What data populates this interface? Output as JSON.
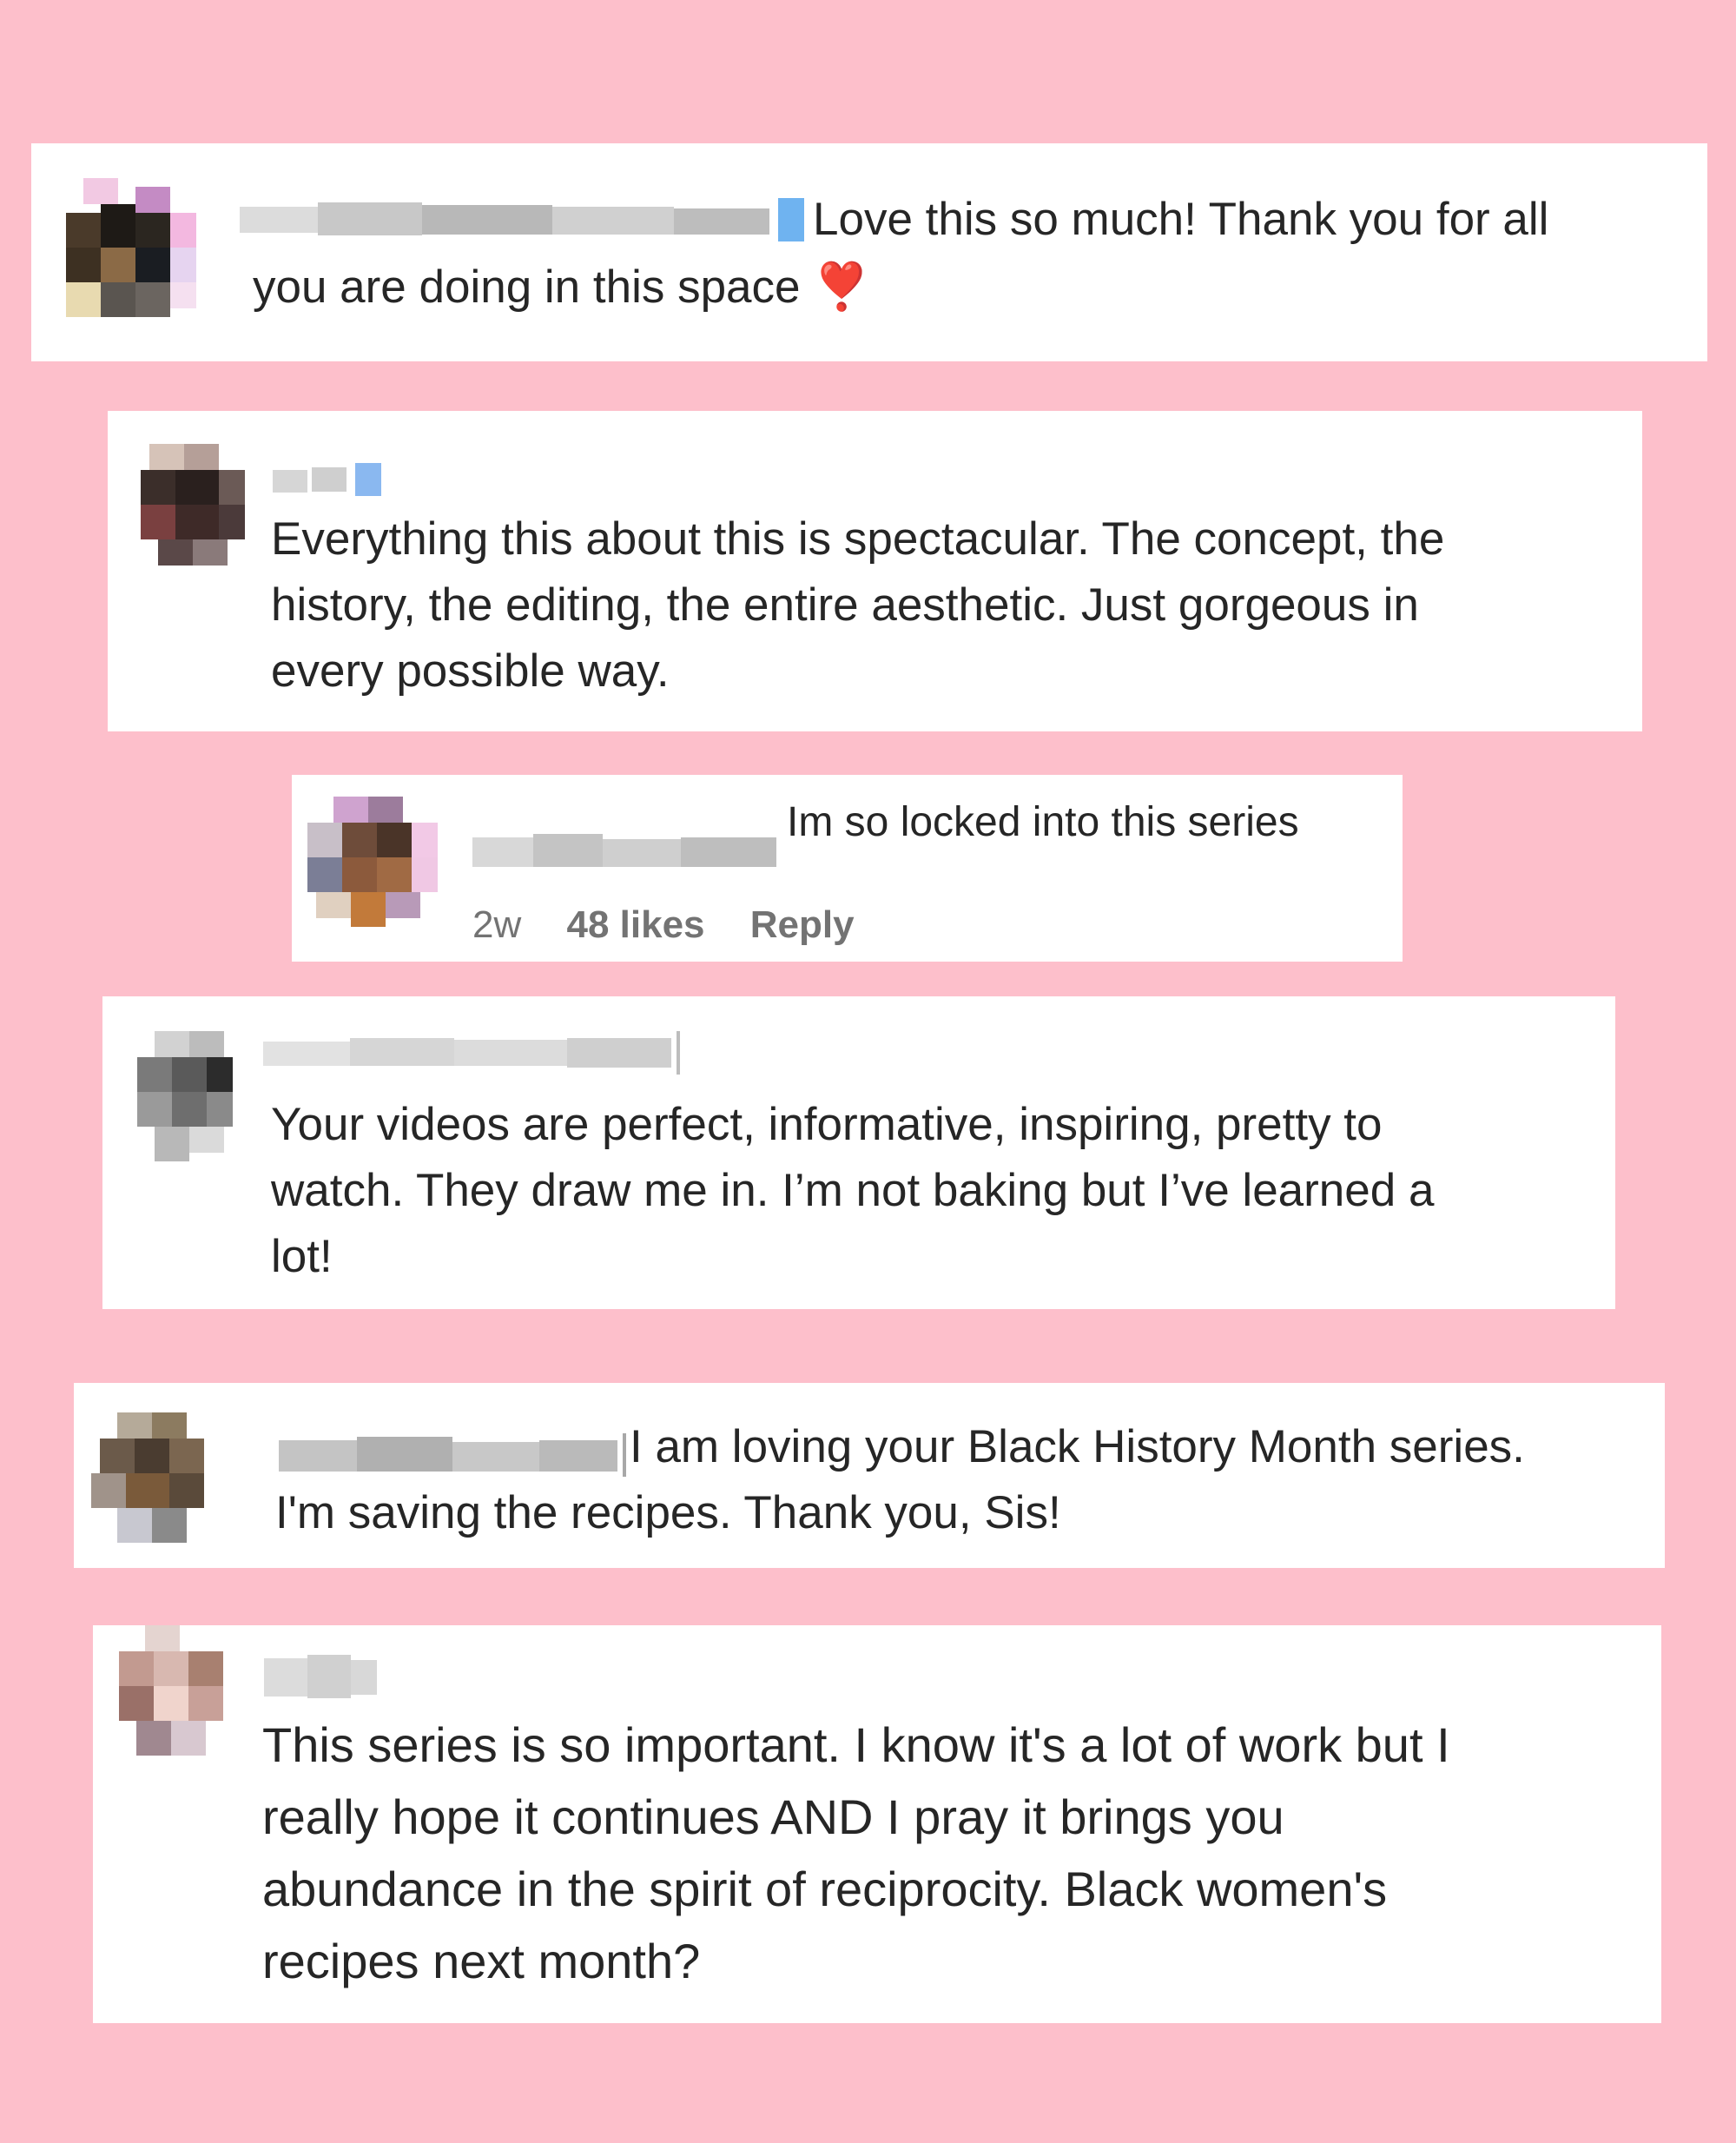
{
  "comments": [
    {
      "id": 1,
      "text_line1": "Love this so much! Thank you for all",
      "text_line2": "you are doing in this space",
      "emoji": "❣️"
    },
    {
      "id": 2,
      "text_line1": "Everything this about this is spectacular. The concept, the",
      "text_line2": "history, the editing, the entire aesthetic. Just gorgeous in",
      "text_line3": "every possible way."
    },
    {
      "id": 3,
      "text": "Im so locked into this series",
      "time": "2w",
      "likes": "48 likes",
      "reply_label": "Reply"
    },
    {
      "id": 4,
      "text_line1": "Your videos are perfect, informative, inspiring, pretty to",
      "text_line2": "watch. They draw me in. I’m not baking but I’ve learned a",
      "text_line3": "lot!"
    },
    {
      "id": 5,
      "text_line1": "I am loving your Black History Month series.",
      "text_line2": "I'm saving the recipes. Thank you, Sis!"
    },
    {
      "id": 6,
      "text_line1": "This series is so important. I know it's a lot of work but I",
      "text_line2": "really hope it continues AND I pray it brings you",
      "text_line3": "abundance in the spirit of reciprocity. Black women's",
      "text_line4": "recipes next month?"
    }
  ]
}
